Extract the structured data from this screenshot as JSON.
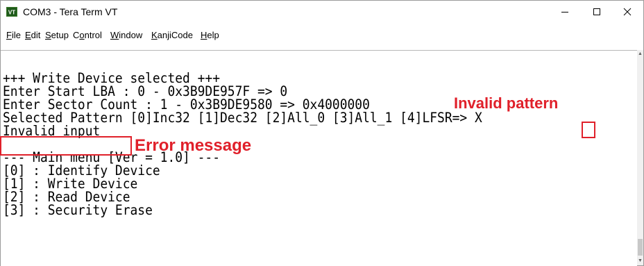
{
  "window": {
    "title": "COM3 - Tera Term VT"
  },
  "menu": {
    "file": {
      "ul": "F",
      "rest": "ile"
    },
    "edit": {
      "ul": "E",
      "rest": "dit"
    },
    "setup": {
      "ul": "S",
      "rest": "etup"
    },
    "control": {
      "pre": "C",
      "ul": "o",
      "rest": "ntrol"
    },
    "window": {
      "ul": "W",
      "rest": "indow"
    },
    "kanjicode": {
      "ul": "K",
      "rest": "anjiCode"
    },
    "help": {
      "ul": "H",
      "rest": "elp"
    }
  },
  "terminal": {
    "lines": [
      "+++ Write Device selected +++",
      "Enter Start LBA : 0 - 0x3B9DE957F => 0",
      "Enter Sector Count : 1 - 0x3B9DE9580 => 0x4000000",
      "Selected Pattern [0]Inc32 [1]Dec32 [2]All_0 [3]All_1 [4]LFSR=> X",
      "Invalid input",
      "",
      "--- Main menu [Ver = 1.0] ---",
      "[0] : Identify Device",
      "[1] : Write Device",
      "[2] : Read Device",
      "[3] : Security Erase"
    ]
  },
  "annotations": {
    "invalid_pattern": "Invalid pattern",
    "error_message": "Error message"
  },
  "colors": {
    "annotation_red": "#e0202a"
  },
  "icons": {
    "app": "tera-term-icon",
    "minimize": "minimize-icon",
    "maximize": "maximize-icon",
    "close": "close-icon"
  }
}
